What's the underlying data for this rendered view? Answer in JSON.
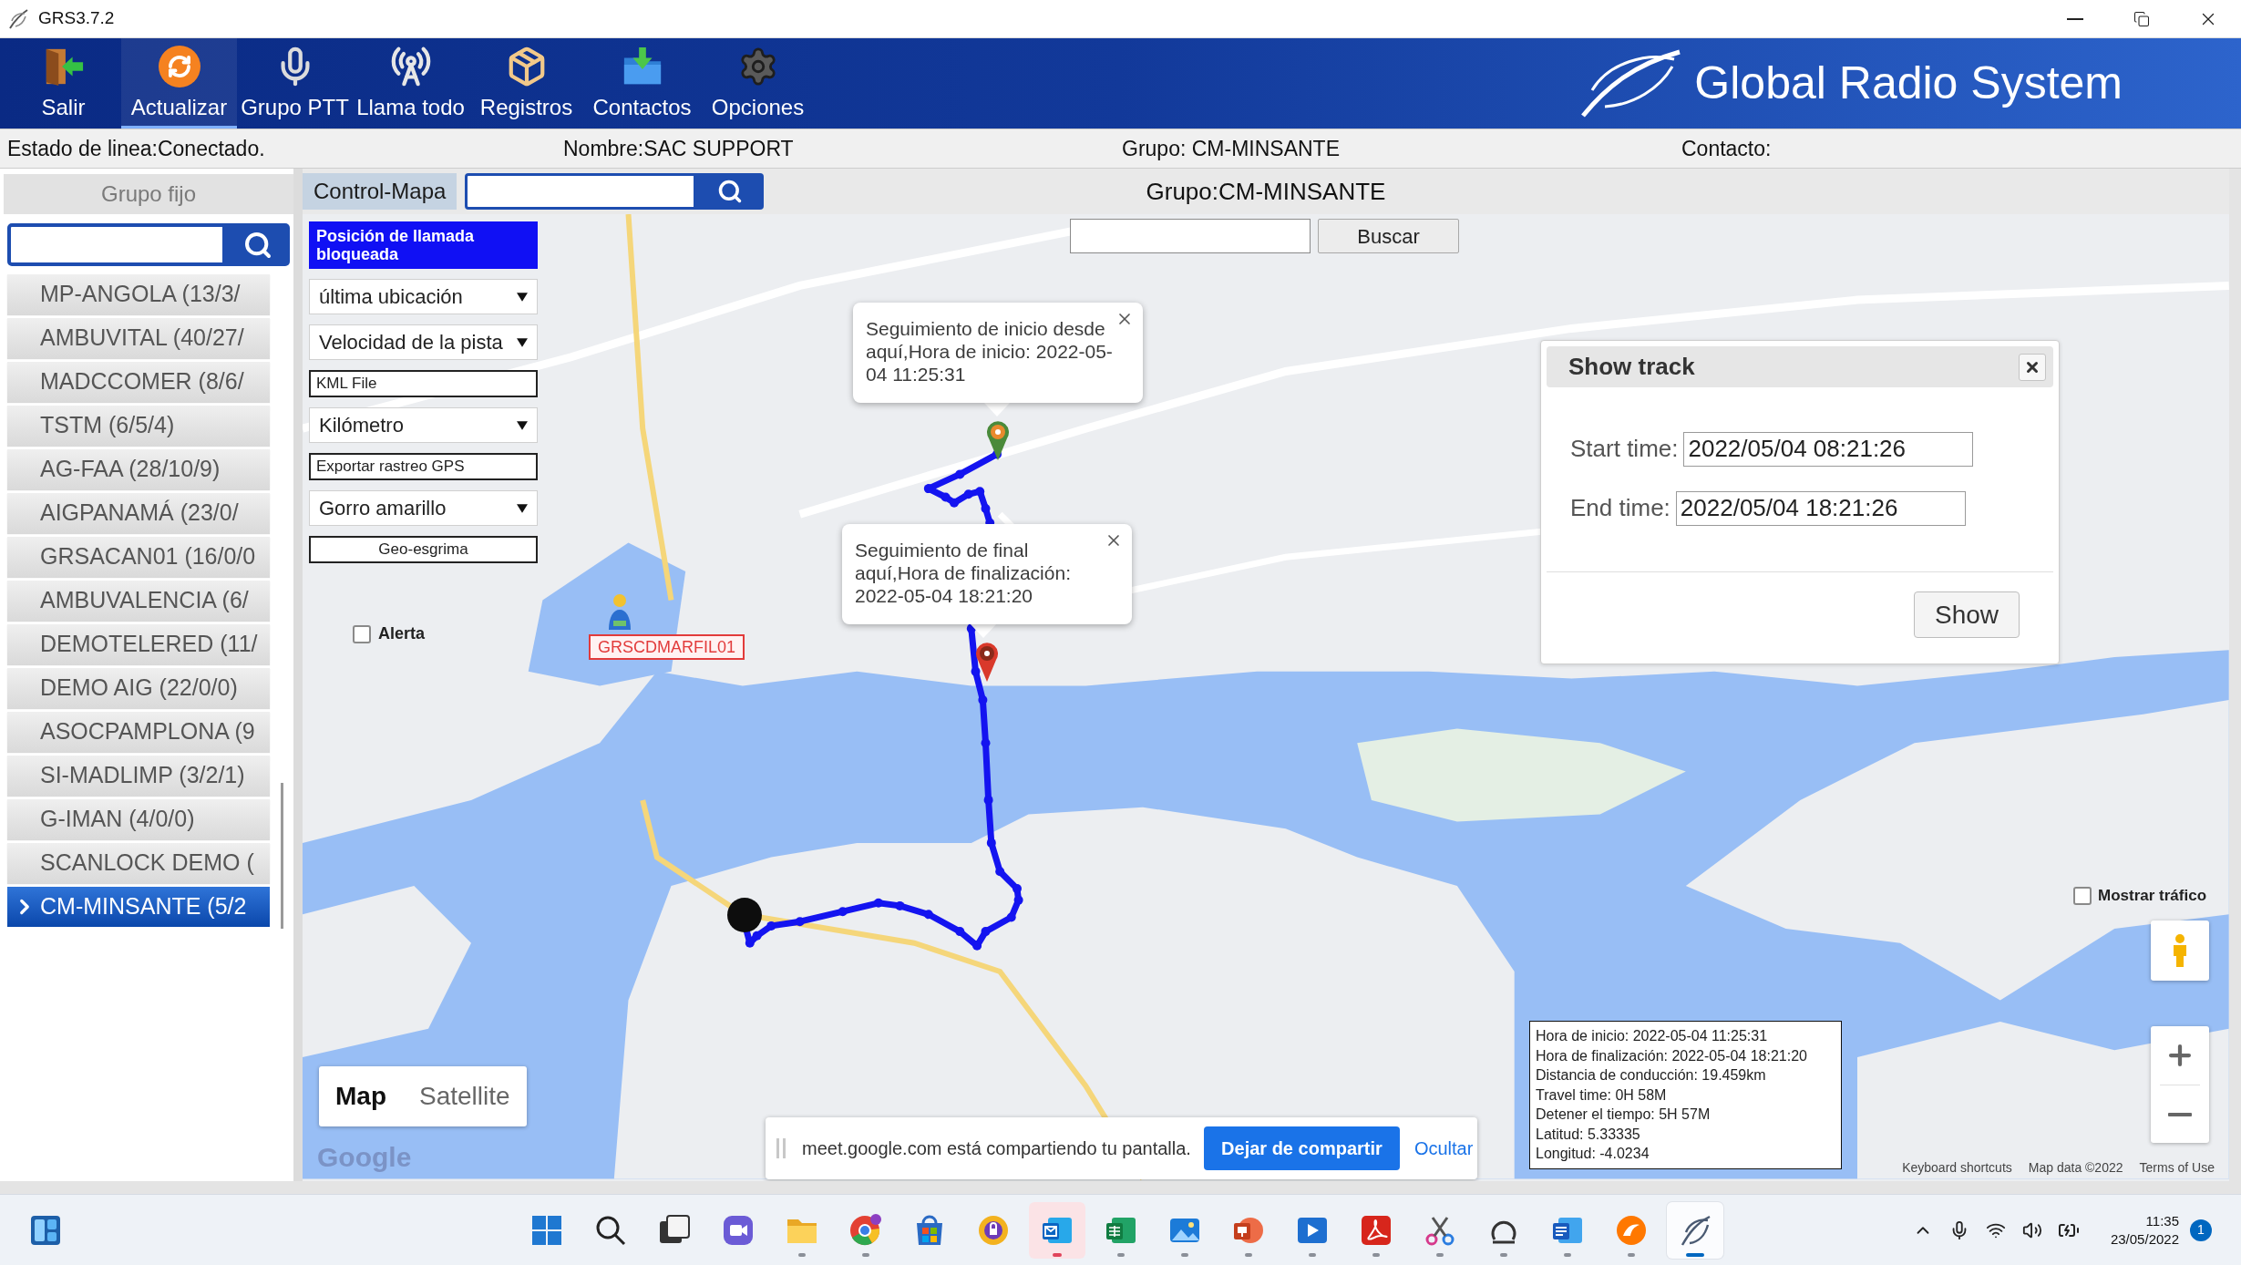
{
  "window": {
    "title": "GRS3.7.2"
  },
  "toolbar": {
    "items": [
      {
        "label": "Salir",
        "selected": false
      },
      {
        "label": "Actualizar",
        "selected": true
      },
      {
        "label": "Grupo PTT",
        "selected": false
      },
      {
        "label": "Llama todo",
        "selected": false
      },
      {
        "label": "Registros",
        "selected": false
      },
      {
        "label": "Contactos",
        "selected": false
      },
      {
        "label": "Opciones",
        "selected": false
      }
    ],
    "brand": "Global Radio System"
  },
  "status_bar": {
    "line_status": "Estado de linea:Conectado.",
    "name": "Nombre:SAC SUPPORT",
    "group": "Grupo: CM-MINSANTE",
    "contact": "Contacto:"
  },
  "sidebar": {
    "header": "Grupo fijo",
    "groups": [
      {
        "label": "MP-ANGOLA (13/3/",
        "selected": false
      },
      {
        "label": "AMBUVITAL (40/27/",
        "selected": false
      },
      {
        "label": "MADCCOMER (8/6/",
        "selected": false
      },
      {
        "label": "TSTM (6/5/4)",
        "selected": false
      },
      {
        "label": "AG-FAA (28/10/9)",
        "selected": false
      },
      {
        "label": "AIGPANAMÁ (23/0/",
        "selected": false
      },
      {
        "label": "GRSACAN01 (16/0/0",
        "selected": false
      },
      {
        "label": "AMBUVALENCIA (6/",
        "selected": false
      },
      {
        "label": "DEMOTELERED (11/",
        "selected": false
      },
      {
        "label": "DEMO AIG (22/0/0)",
        "selected": false
      },
      {
        "label": "ASOCPAMPLONA (9",
        "selected": false
      },
      {
        "label": "SI-MADLIMP (3/2/1)",
        "selected": false
      },
      {
        "label": "G-IMAN (4/0/0)",
        "selected": false
      },
      {
        "label": "SCANLOCK DEMO (",
        "selected": false
      },
      {
        "label": "CM-MINSANTE (5/2",
        "selected": true
      }
    ]
  },
  "map_panel": {
    "tab": "Control-Mapa",
    "title": "Grupo:CM-MINSANTE",
    "controls": [
      {
        "kind": "toggle",
        "label": "Posición de llamada bloqueada"
      },
      {
        "kind": "select",
        "label": "última ubicación"
      },
      {
        "kind": "select",
        "label": "Velocidad de la pista"
      },
      {
        "kind": "action",
        "label": "KML File"
      },
      {
        "kind": "select",
        "label": "Kilómetro"
      },
      {
        "kind": "action",
        "label": "Exportar rastreo GPS"
      },
      {
        "kind": "select",
        "label": "Gorro amarillo"
      },
      {
        "kind": "button",
        "label": "Geo-esgrima"
      }
    ],
    "alert": {
      "label": "Alerta",
      "checked": false
    },
    "search_button": "Buscar",
    "popups": [
      {
        "text": "Seguimiento de inicio desde aquí,Hora de inicio: 2022-05-04 11:25:31"
      },
      {
        "text": "Seguimiento de final aquí,Hora de finalización: 2022-05-04 18:21:20"
      }
    ],
    "unit_label": "GRSCDMARFIL01",
    "show_track": {
      "title": "Show track",
      "start_label": "Start time:",
      "start_value": "2022/05/04 08:21:26",
      "end_label": "End time:",
      "end_value": "2022/05/04 18:21:26",
      "button": "Show"
    },
    "traffic": {
      "label": "Mostrar tráfico",
      "checked": false
    },
    "track_info": [
      "Hora de inicio: 2022-05-04 11:25:31",
      "Hora de finalización: 2022-05-04 18:21:20",
      "Distancia de conducción: 19.459km",
      "Travel time: 0H 58M",
      "Detener el tiempo: 5H 57M",
      "Latitud: 5.33335",
      "Longitud: -4.0234"
    ],
    "map_types": [
      {
        "label": "Map",
        "selected": true
      },
      {
        "label": "Satellite",
        "selected": false
      }
    ],
    "logo": "Google",
    "attribution": [
      "Keyboard shortcuts",
      "Map data ©2022",
      "Terms of Use"
    ]
  },
  "share_bar": {
    "message": "meet.google.com está compartiendo tu pantalla.",
    "stop_button": "Dejar de compartir",
    "hide_link": "Ocultar"
  },
  "taskbar": {
    "buttons": [
      {
        "running": false,
        "selected": false,
        "flashing": false
      },
      {
        "running": false,
        "selected": false,
        "flashing": false
      },
      {
        "running": false,
        "selected": false,
        "flashing": false
      },
      {
        "running": false,
        "selected": false,
        "flashing": false
      },
      {
        "running": true,
        "selected": false,
        "flashing": false
      },
      {
        "running": true,
        "selected": false,
        "flashing": false
      },
      {
        "running": false,
        "selected": false,
        "flashing": false
      },
      {
        "running": false,
        "selected": false,
        "flashing": false
      },
      {
        "running": true,
        "selected": false,
        "flashing": true
      },
      {
        "running": true,
        "selected": false,
        "flashing": false
      },
      {
        "running": true,
        "selected": false,
        "flashing": false
      },
      {
        "running": true,
        "selected": false,
        "flashing": false
      },
      {
        "running": true,
        "selected": false,
        "flashing": false
      },
      {
        "running": true,
        "selected": false,
        "flashing": false
      },
      {
        "running": true,
        "selected": false,
        "flashing": false
      },
      {
        "running": true,
        "selected": false,
        "flashing": false
      },
      {
        "running": true,
        "selected": false,
        "flashing": false
      },
      {
        "running": true,
        "selected": false,
        "flashing": false
      },
      {
        "running": true,
        "selected": true,
        "flashing": false
      }
    ],
    "time": "11:35",
    "date": "23/05/2022",
    "notifications": "1"
  }
}
